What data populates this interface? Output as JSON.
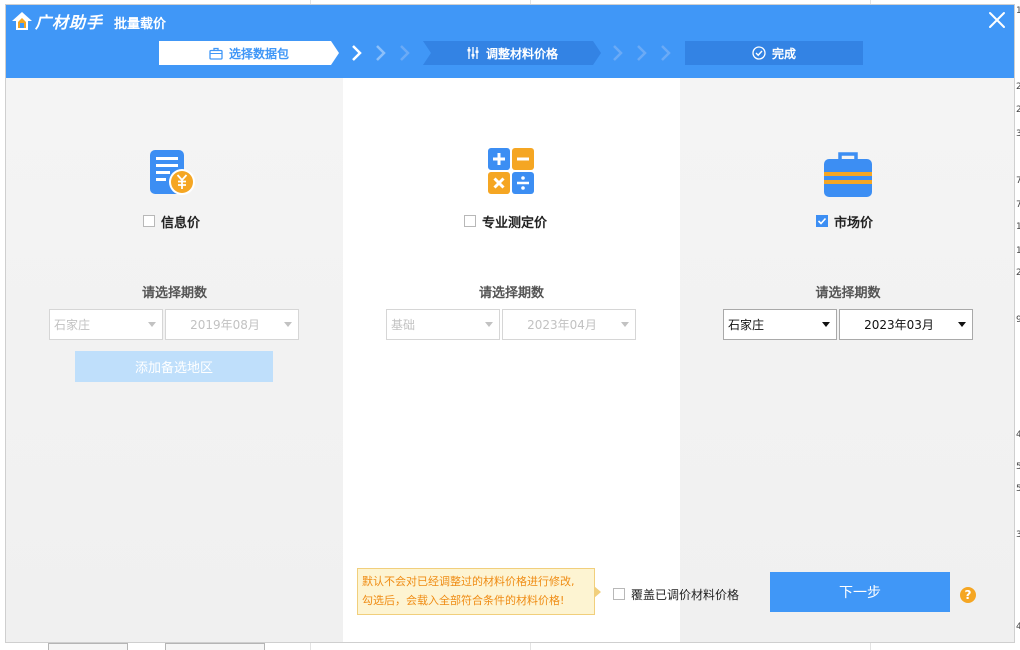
{
  "app": {
    "logo_text": "广材助手",
    "title": "批量载价"
  },
  "steps": [
    {
      "label": "选择数据包",
      "icon": "briefcase-icon",
      "state": "active"
    },
    {
      "label": "调整材料价格",
      "icon": "sliders-icon",
      "state": "pending"
    },
    {
      "label": "完成",
      "icon": "check-circle-icon",
      "state": "pending"
    }
  ],
  "columns": [
    {
      "option_label": "信息价",
      "checked": false,
      "icon": "info-price-icon",
      "period_label": "请选择期数",
      "region": "石家庄",
      "period": "2019年08月",
      "enabled": false,
      "add_region_label": "添加备选地区"
    },
    {
      "option_label": "专业测定价",
      "checked": false,
      "icon": "calculator-icon",
      "period_label": "请选择期数",
      "region": "基础",
      "period": "2023年04月",
      "enabled": false
    },
    {
      "option_label": "市场价",
      "checked": true,
      "icon": "market-briefcase-icon",
      "period_label": "请选择期数",
      "region": "石家庄",
      "period": "2023年03月",
      "enabled": true
    }
  ],
  "footer": {
    "tip_line1": "默认不会对已经调整过的材料价格进行修改,",
    "tip_line2": "勾选后，会载入全部符合条件的材料价格!",
    "override_label": "覆盖已调价材料价格",
    "override_checked": false,
    "next_label": "下一步",
    "help": "?"
  },
  "colors": {
    "accent": "#4097f7",
    "orange": "#f5a623",
    "tip_bg": "#fdf4d2",
    "tip_text": "#ef8c14"
  },
  "background_sheet": {
    "right_column_values": [
      "1",
      "2",
      "2",
      "3",
      "7",
      "7",
      "1",
      "1",
      "2",
      "9",
      "4",
      "5",
      "5",
      "3",
      "4"
    ]
  }
}
